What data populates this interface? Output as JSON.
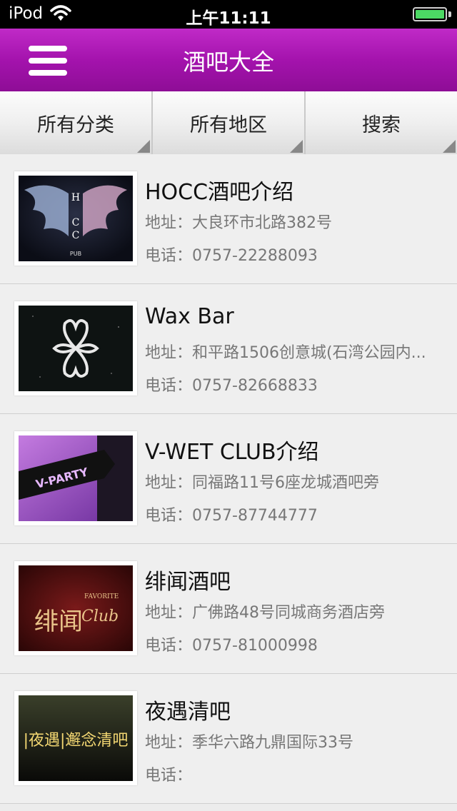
{
  "status_bar": {
    "carrier": "iPod",
    "time": "上午11:11"
  },
  "nav": {
    "title": "酒吧大全"
  },
  "filters": [
    "所有分类",
    "所有地区",
    "搜索"
  ],
  "addr_prefix": "地址：",
  "phone_prefix": "电话：",
  "bars": [
    {
      "name": "HOCC酒吧介绍",
      "address": "大良环市北路382号",
      "phone": "0757-22288093"
    },
    {
      "name": "Wax Bar",
      "address": "和平路1506创意城(石湾公园内...",
      "phone": "0757-82668833"
    },
    {
      "name": "V-WET CLUB介绍",
      "address": "同福路11号6座龙城酒吧旁",
      "phone": "0757-87744777"
    },
    {
      "name": "绯闻酒吧",
      "address": "广佛路48号同城商务酒店旁",
      "phone": "0757-81000998"
    },
    {
      "name": "夜遇清吧",
      "address": "季华六路九鼎国际33号",
      "phone": ""
    }
  ],
  "thumb_text": {
    "hocc": [
      "H",
      "C",
      "C",
      "PUB"
    ],
    "vparty": "V-PARTY",
    "favorite": [
      "FAVORITE",
      "Club",
      "绯闻"
    ],
    "yeyu": "|夜遇|邂念清吧"
  }
}
